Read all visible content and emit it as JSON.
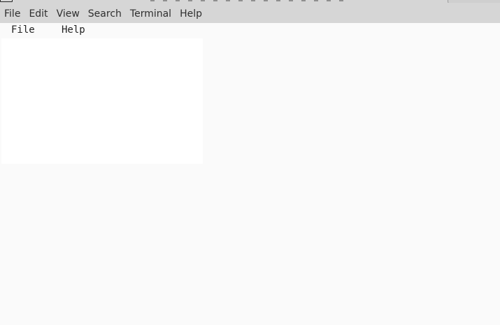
{
  "window": {
    "menu": [
      "File",
      "Edit",
      "View",
      "Search",
      "Terminal",
      "Help"
    ]
  },
  "app": {
    "menu": [
      "File",
      "Help"
    ]
  }
}
